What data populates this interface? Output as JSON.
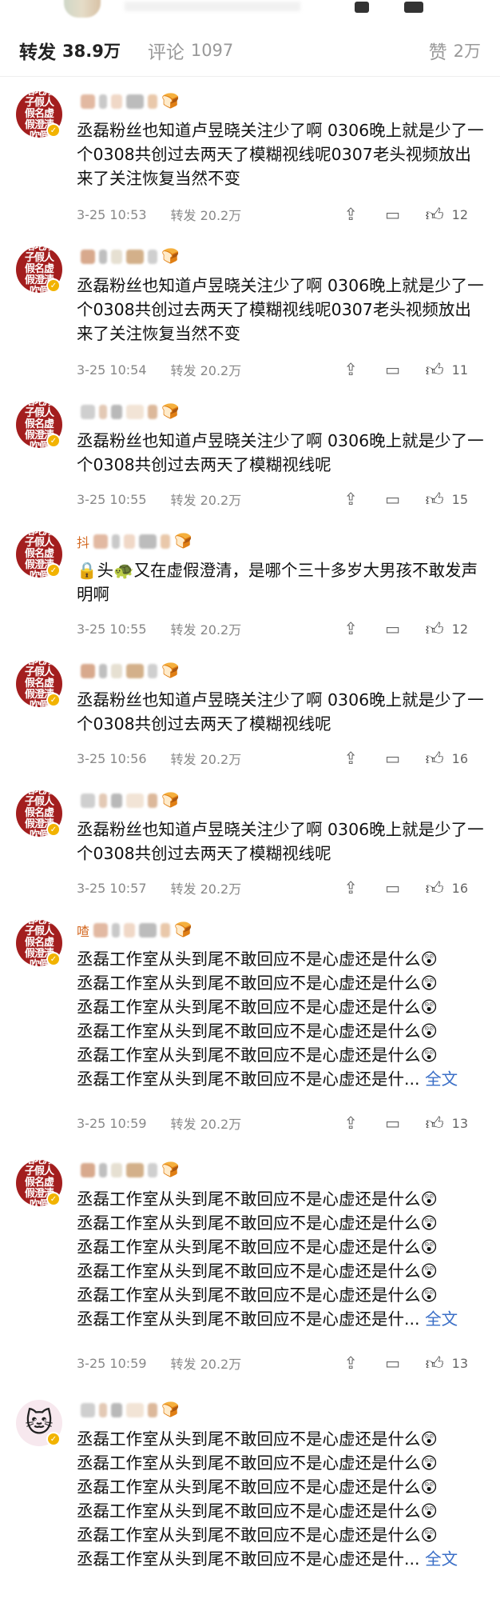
{
  "tabs": {
    "reposts": {
      "label": "转发",
      "count": "38.9万"
    },
    "comments": {
      "label": "评论",
      "count": "1097"
    },
    "likes": {
      "label": "赞",
      "count": "2万"
    }
  },
  "avatar_seal_text": "落坨翔子假人假名虚假澄清吹假",
  "comments": [
    {
      "prefix": "",
      "text": "丞磊粉丝也知道卢昱晓关注少了啊 0306晚上就是少了一个0308共创过去两天了模糊视线呢0307老头视频放出来了关注恢复当然不变",
      "time": "3-25 10:53",
      "repost": "转发 20.2万",
      "likes": "12"
    },
    {
      "prefix": "",
      "text": "丞磊粉丝也知道卢昱晓关注少了啊 0306晚上就是少了一个0308共创过去两天了模糊视线呢0307老头视频放出来了关注恢复当然不变",
      "time": "3-25 10:54",
      "repost": "转发 20.2万",
      "likes": "11"
    },
    {
      "prefix": "",
      "text": "丞磊粉丝也知道卢昱晓关注少了啊 0306晚上就是少了一个0308共创过去两天了模糊视线呢",
      "time": "3-25 10:55",
      "repost": "转发 20.2万",
      "likes": "15"
    },
    {
      "prefix": "抖",
      "text": "🔒头🐢又在虚假澄清，是哪个三十多岁大男孩不敢发声明啊",
      "time": "3-25 10:55",
      "repost": "转发 20.2万",
      "likes": "12"
    },
    {
      "prefix": "",
      "text": "丞磊粉丝也知道卢昱晓关注少了啊 0306晚上就是少了一个0308共创过去两天了模糊视线呢",
      "time": "3-25 10:56",
      "repost": "转发 20.2万",
      "likes": "16"
    },
    {
      "prefix": "",
      "text": "丞磊粉丝也知道卢昱晓关注少了啊 0306晚上就是少了一个0308共创过去两天了模糊视线呢",
      "time": "3-25 10:57",
      "repost": "转发 20.2万",
      "likes": "16"
    },
    {
      "prefix": "喳",
      "text": "丞磊工作室从头到尾不敢回应不是心虚还是什么😲\n丞磊工作室从头到尾不敢回应不是心虚还是什么😲\n丞磊工作室从头到尾不敢回应不是心虚还是什么😲\n丞磊工作室从头到尾不敢回应不是心虚还是什么😲\n丞磊工作室从头到尾不敢回应不是心虚还是什么😲\n丞磊工作室从头到尾不敢回应不是心虚还是什...",
      "fulltext": "全文",
      "time": "3-25 10:59",
      "repost": "转发 20.2万",
      "likes": "13"
    },
    {
      "prefix": "",
      "text": "丞磊工作室从头到尾不敢回应不是心虚还是什么😲\n丞磊工作室从头到尾不敢回应不是心虚还是什么😲\n丞磊工作室从头到尾不敢回应不是心虚还是什么😲\n丞磊工作室从头到尾不敢回应不是心虚还是什么😲\n丞磊工作室从头到尾不敢回应不是心虚还是什么😲\n丞磊工作室从头到尾不敢回应不是心虚还是什...",
      "fulltext": "全文",
      "time": "3-25 10:59",
      "repost": "转发 20.2万",
      "likes": "13"
    },
    {
      "prefix": "",
      "text": "丞磊工作室从头到尾不敢回应不是心虚还是什么😲\n丞磊工作室从头到尾不敢回应不是心虚还是什么😲\n丞磊工作室从头到尾不敢回应不是心虚还是什么😲\n丞磊工作室从头到尾不敢回应不是心虚还是什么😲\n丞磊工作室从头到尾不敢回应不是心虚还是什么😲\n丞磊工作室从头到尾不敢回应不是心虚还是什...",
      "fulltext": "全文",
      "time": "",
      "repost": "",
      "likes": ""
    }
  ],
  "icons": {
    "share": "share-icon",
    "message": "message-icon",
    "like": "thumbs-up-icon",
    "verified": "verified-badge-icon"
  },
  "colors": {
    "verified": "#f2b300",
    "avatar_bg": "#a31e1e",
    "link": "#3b6fc7"
  }
}
